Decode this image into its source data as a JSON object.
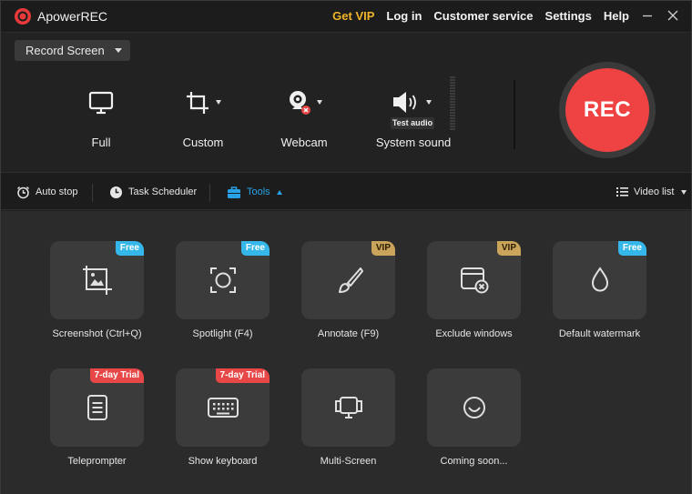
{
  "titlebar": {
    "app_name": "ApowerREC",
    "menu": [
      "Get VIP",
      "Log in",
      "Customer service",
      "Settings",
      "Help"
    ],
    "logo_icon": "record-logo-icon",
    "accent_vip": "#f0b429"
  },
  "record": {
    "mode": "Record Screen",
    "sources": [
      {
        "label": "Full",
        "icon": "monitor-icon"
      },
      {
        "label": "Custom",
        "icon": "crop-icon"
      },
      {
        "label": "Webcam",
        "icon": "webcam-icon"
      },
      {
        "label": "System sound",
        "icon": "speaker-icon"
      }
    ],
    "test_audio": "Test audio",
    "rec_label": "REC",
    "rec_color": "#ef4343"
  },
  "toolbar": {
    "auto_stop": "Auto stop",
    "task_scheduler": "Task Scheduler",
    "tools": "Tools",
    "video_list": "Video list",
    "active_color": "#29a3e8"
  },
  "tools": [
    {
      "label": "Screenshot (Ctrl+Q)",
      "badge": "Free",
      "icon": "screenshot-icon"
    },
    {
      "label": "Spotlight (F4)",
      "badge": "Free",
      "icon": "spotlight-icon"
    },
    {
      "label": "Annotate (F9)",
      "badge": "VIP",
      "icon": "brush-icon"
    },
    {
      "label": "Exclude windows",
      "badge": "VIP",
      "icon": "exclude-window-icon"
    },
    {
      "label": "Default watermark",
      "badge": "Free",
      "icon": "watermark-drop-icon"
    },
    {
      "label": "Teleprompter",
      "badge": "7-day Trial",
      "icon": "teleprompter-icon"
    },
    {
      "label": "Show keyboard",
      "badge": "7-day Trial",
      "icon": "keyboard-icon"
    },
    {
      "label": "Multi-Screen",
      "badge": "",
      "icon": "multi-screen-icon"
    },
    {
      "label": "Coming soon...",
      "badge": "",
      "icon": "loading-icon"
    }
  ]
}
